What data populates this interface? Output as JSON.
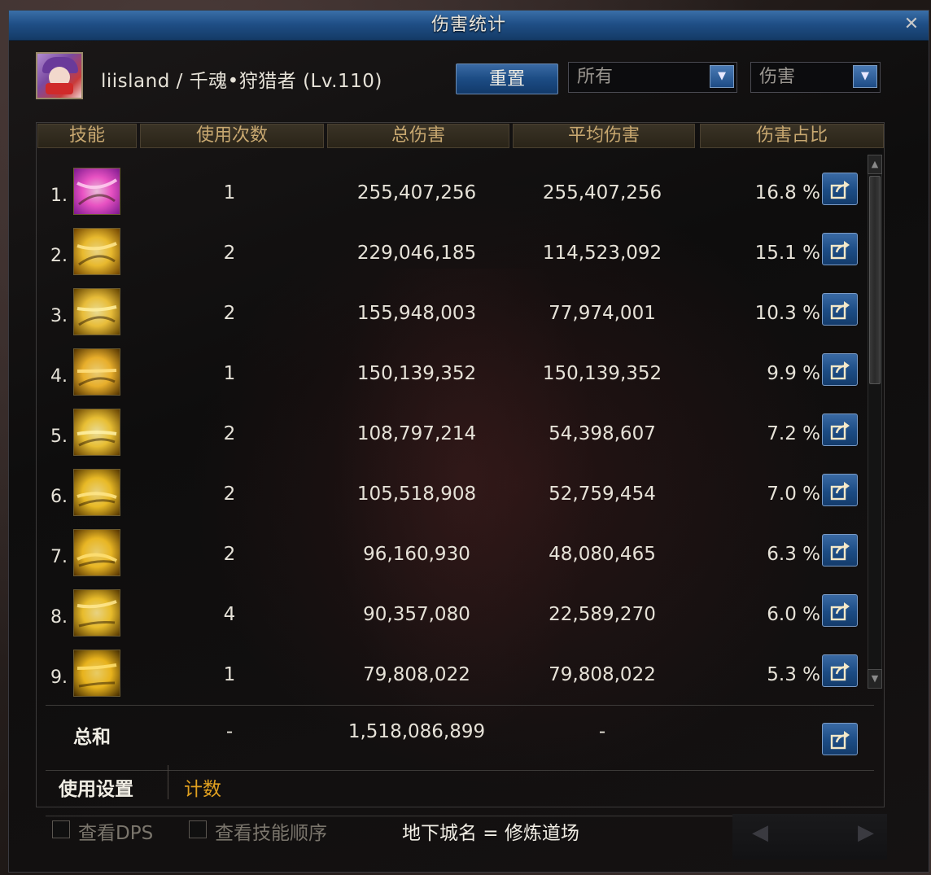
{
  "window": {
    "title": "伤害统计",
    "close_label": "✕"
  },
  "player": {
    "name": "liisland / 千魂•狩猎者 (Lv.110)"
  },
  "controls": {
    "reset_label": "重置",
    "filter": {
      "value": "所有"
    },
    "metric": {
      "value": "伤害"
    }
  },
  "table": {
    "headers": {
      "skill": "技能",
      "uses": "使用次数",
      "total": "总伤害",
      "avg": "平均伤害",
      "pct": "伤害占比"
    },
    "rows": [
      {
        "rank": "1.",
        "uses": "1",
        "total": "255,407,256",
        "avg": "255,407,256",
        "pct": "16.8 %"
      },
      {
        "rank": "2.",
        "uses": "2",
        "total": "229,046,185",
        "avg": "114,523,092",
        "pct": "15.1 %"
      },
      {
        "rank": "3.",
        "uses": "2",
        "total": "155,948,003",
        "avg": "77,974,001",
        "pct": "10.3 %"
      },
      {
        "rank": "4.",
        "uses": "1",
        "total": "150,139,352",
        "avg": "150,139,352",
        "pct": "9.9 %"
      },
      {
        "rank": "5.",
        "uses": "2",
        "total": "108,797,214",
        "avg": "54,398,607",
        "pct": "7.2 %"
      },
      {
        "rank": "6.",
        "uses": "2",
        "total": "105,518,908",
        "avg": "52,759,454",
        "pct": "7.0 %"
      },
      {
        "rank": "7.",
        "uses": "2",
        "total": "96,160,930",
        "avg": "48,080,465",
        "pct": "6.3 %"
      },
      {
        "rank": "8.",
        "uses": "4",
        "total": "90,357,080",
        "avg": "22,589,270",
        "pct": "6.0 %"
      },
      {
        "rank": "9.",
        "uses": "1",
        "total": "79,808,022",
        "avg": "79,808,022",
        "pct": "5.3 %"
      }
    ]
  },
  "summary": {
    "label": "总和",
    "uses": "-",
    "total": "1,518,086,899",
    "avg": "-"
  },
  "tabs": {
    "settings": "使用设置",
    "count": "计数"
  },
  "footer": {
    "view_dps": "查看DPS",
    "view_skill_order": "查看技能顺序",
    "dungeon": "地下城名 = 修炼道场",
    "prev_icon": "◀",
    "next_icon": "▶"
  },
  "colors": {
    "title_bar": "#1f4f86",
    "accent_gold": "#e0a020",
    "header_text": "#c8a870"
  }
}
